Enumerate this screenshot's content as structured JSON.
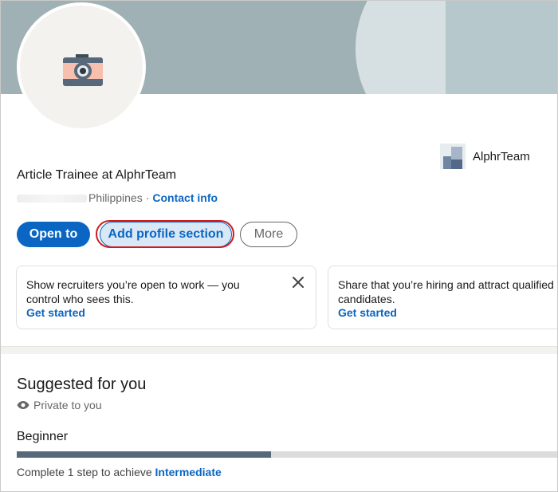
{
  "profile": {
    "headline": "Article Trainee at AlphrTeam",
    "location": "Philippines",
    "contact_link": "Contact info",
    "company": "AlphrTeam"
  },
  "actions": {
    "open_to": "Open to",
    "add_section": "Add profile section",
    "more": "More"
  },
  "cards": [
    {
      "text_bold": "Show recruiters you’re open to work",
      "text_rest": " — you control who sees this.",
      "link": "Get started"
    },
    {
      "text_bold": "Share that you’re hiring",
      "text_rest": " and attract qualified candidates.",
      "link": "Get started"
    }
  ],
  "suggested": {
    "title": "Suggested for you",
    "privacy": "Private to you",
    "level": "Beginner",
    "progress_fraction": 0.47,
    "complete_prefix": "Complete 1 step to achieve ",
    "next_level": "Intermediate"
  },
  "colors": {
    "accent": "#0a66c2",
    "highlight": "#d11a20"
  },
  "icons": [
    "camera-icon",
    "close-icon",
    "eye-icon"
  ]
}
